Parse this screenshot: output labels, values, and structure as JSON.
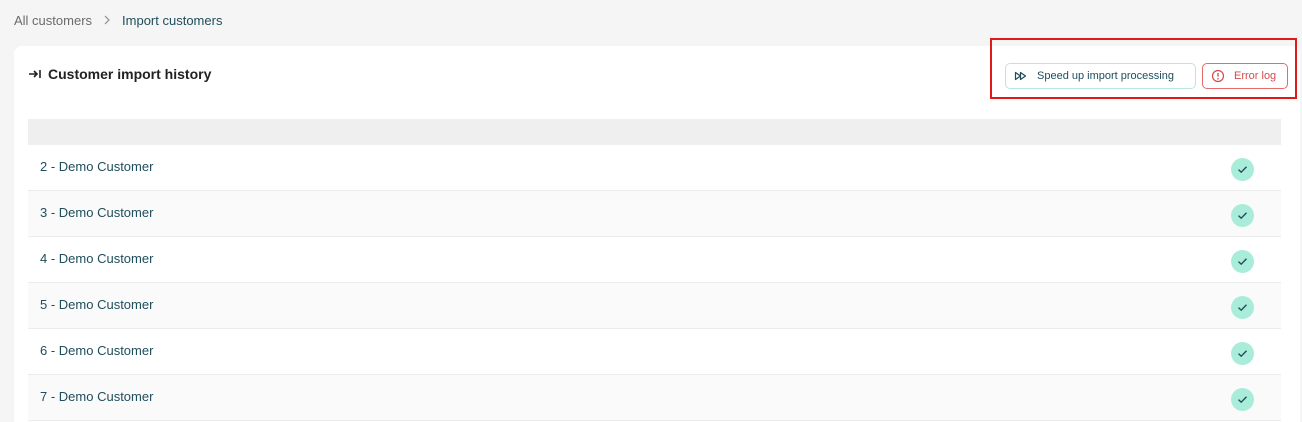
{
  "breadcrumb": {
    "parent": "All customers",
    "separator": ">",
    "current": "Import customers"
  },
  "card": {
    "title": "Customer import history",
    "title_icon": "import-arrow-icon"
  },
  "actions": {
    "speed_up_label": "Speed up import processing",
    "speed_up_icon": "fast-forward-icon",
    "error_log_label": "Error log",
    "error_log_icon": "alert-circle-icon"
  },
  "rows": [
    {
      "label": "2 - Demo Customer",
      "status": "success"
    },
    {
      "label": "3 - Demo Customer",
      "status": "success"
    },
    {
      "label": "4 - Demo Customer",
      "status": "success"
    },
    {
      "label": "5 - Demo Customer",
      "status": "success"
    },
    {
      "label": "6 - Demo Customer",
      "status": "success"
    },
    {
      "label": "7 - Demo Customer",
      "status": "success"
    }
  ],
  "colors": {
    "accent_text": "#1f4d5b",
    "success_badge": "#a9ecd9",
    "error": "#d34b4b",
    "highlight": "#e01919"
  }
}
